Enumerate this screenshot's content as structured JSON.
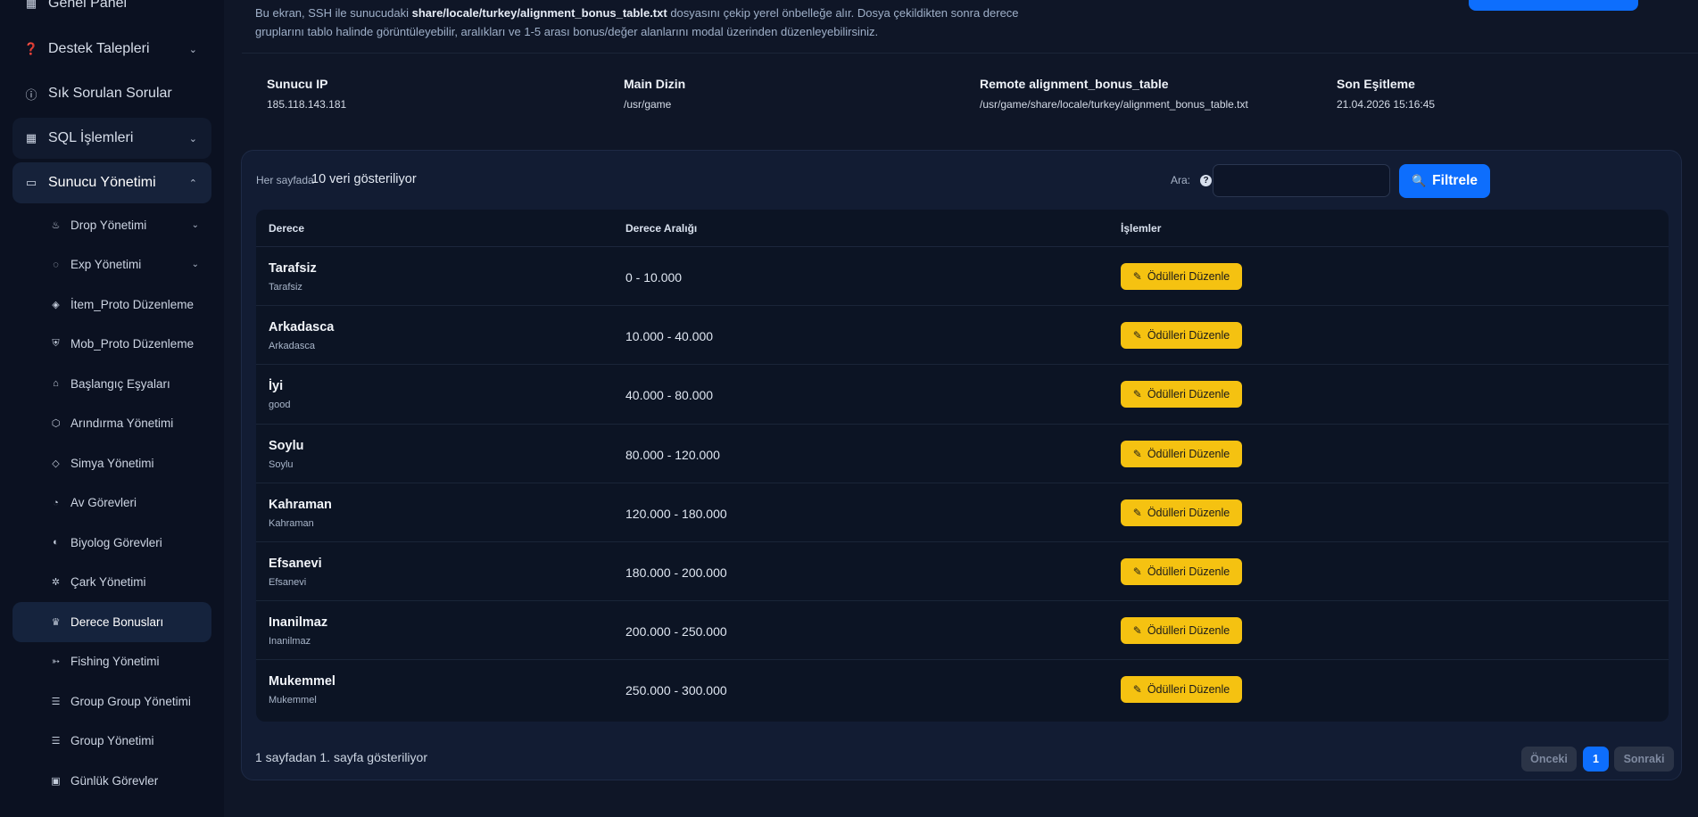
{
  "sidebar": {
    "top_items": [
      {
        "label": "Genel Panel",
        "icon": "grid-icon",
        "chevron": false
      },
      {
        "label": "Destek Talepleri",
        "icon": "help-circle-icon",
        "chevron": true
      },
      {
        "label": "Sık Sorulan Sorular",
        "icon": "question-circle-icon",
        "chevron": false
      },
      {
        "label": "SQL İşlemleri",
        "icon": "grid-icon",
        "chevron": true
      },
      {
        "label": "Sunucu Yönetimi",
        "icon": "monitor-icon",
        "chevron": true
      }
    ],
    "sub_items": [
      {
        "label": "Drop Yönetimi",
        "icon": "flame-icon",
        "chevron": true
      },
      {
        "label": "Exp Yönetimi",
        "icon": "bulb-icon",
        "chevron": true
      },
      {
        "label": "İtem_Proto Düzenleme",
        "icon": "layers-icon",
        "chevron": false
      },
      {
        "label": "Mob_Proto Düzenleme",
        "icon": "shield-icon",
        "chevron": false
      },
      {
        "label": "Başlangıç Eşyaları",
        "icon": "gift-icon",
        "chevron": false
      },
      {
        "label": "Arındırma Yönetimi",
        "icon": "box-icon",
        "chevron": false
      },
      {
        "label": "Simya Yönetimi",
        "icon": "gem-icon",
        "chevron": false
      },
      {
        "label": "Av Görevleri",
        "icon": "target-icon",
        "chevron": false
      },
      {
        "label": "Biyolog Görevleri",
        "icon": "leaf-icon",
        "chevron": false
      },
      {
        "label": "Çark Yönetimi",
        "icon": "wheel-icon",
        "chevron": false
      },
      {
        "label": "Derece Bonusları",
        "icon": "trophy-icon",
        "chevron": false
      },
      {
        "label": "Fishing Yönetimi",
        "icon": "fish-icon",
        "chevron": false
      },
      {
        "label": "Group Group Yönetimi",
        "icon": "list-icon",
        "chevron": false
      },
      {
        "label": "Group Yönetimi",
        "icon": "list-icon",
        "chevron": false
      },
      {
        "label": "Günlük Görevler",
        "icon": "calendar-icon",
        "chevron": false
      }
    ]
  },
  "description": {
    "part1": "Bu ekran, SSH ile sunucudaki ",
    "file": "share/locale/turkey/alignment_bonus_table.txt",
    "part2": " dosyasını çekip yerel önbelleğe alır. Dosya çekildikten sonra derece gruplarını tablo halinde görüntüleyebilir, aralıkları ve 1-5 arası bonus/değer alanlarını modal üzerinden düzenleyebilirsiniz."
  },
  "info": {
    "ip_label": "Sunucu IP",
    "ip_value": "185.118.143.181",
    "dir_label": "Main Dizin",
    "dir_value": "/usr/game",
    "remote_label": "Remote alignment_bonus_table",
    "remote_value": "/usr/game/share/locale/turkey/alignment_bonus_table.txt",
    "sync_label": "Son Eşitleme",
    "sync_value": "21.04.2026 15:16:45"
  },
  "controls": {
    "per_page_label": "Her sayfada",
    "per_page_value": "10 veri gösteriliyor",
    "search_label": "Ara:",
    "search_help": "?",
    "search_value": "",
    "filter_label": "Filtrele"
  },
  "table": {
    "headers": [
      "Derece",
      "Derece Aralığı",
      "İşlemler"
    ],
    "action_label": "Ödülleri Düzenle",
    "rows": [
      {
        "name": "Tarafsiz",
        "sub": "Tarafsiz",
        "range": "0 - 10.000"
      },
      {
        "name": "Arkadasca",
        "sub": "Arkadasca",
        "range": "10.000 - 40.000"
      },
      {
        "name": "İyi",
        "sub": "good",
        "range": "40.000 - 80.000"
      },
      {
        "name": "Soylu",
        "sub": "Soylu",
        "range": "80.000 - 120.000"
      },
      {
        "name": "Kahraman",
        "sub": "Kahraman",
        "range": "120.000 - 180.000"
      },
      {
        "name": "Efsanevi",
        "sub": "Efsanevi",
        "range": "180.000 - 200.000"
      },
      {
        "name": "Inanilmaz",
        "sub": "Inanilmaz",
        "range": "200.000 - 250.000"
      },
      {
        "name": "Mukemmel",
        "sub": "Mukemmel",
        "range": "250.000 - 300.000"
      }
    ]
  },
  "pagination": {
    "summary": "1 sayfadan 1. sayfa gösteriliyor",
    "prev": "Önceki",
    "current": "1",
    "next": "Sonraki"
  },
  "colors": {
    "accent": "#0d6efd",
    "action": "#f5c211",
    "background": "#0f1627",
    "sidebar": "#0b1121"
  }
}
